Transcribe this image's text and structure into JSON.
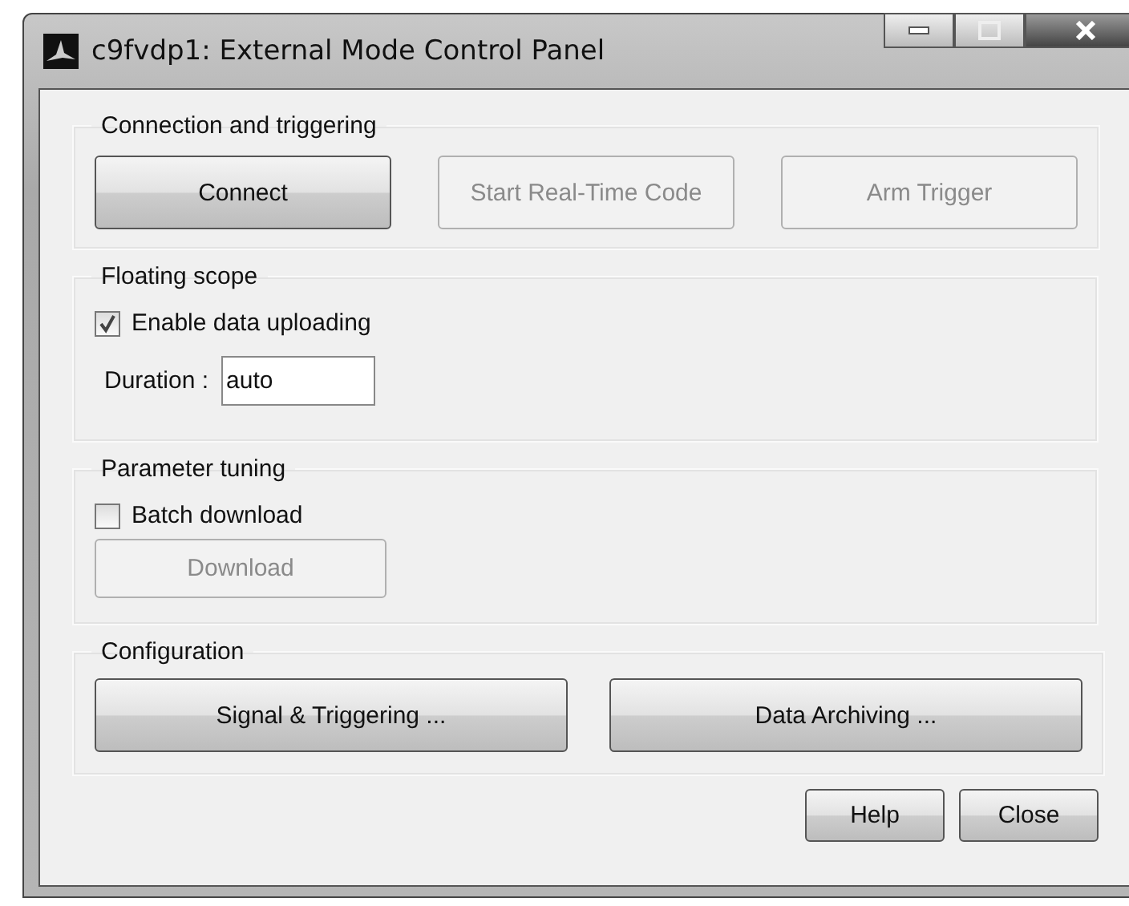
{
  "window": {
    "title": "c9fvdp1: External Mode Control Panel"
  },
  "connection": {
    "title": "Connection and triggering",
    "buttons": [
      {
        "label": "Connect",
        "disabled": false
      },
      {
        "label": "Start Real-Time Code",
        "disabled": true
      },
      {
        "label": "Arm Trigger",
        "disabled": true
      }
    ]
  },
  "floating_scope": {
    "title": "Floating scope",
    "checkbox": {
      "label": "Enable data uploading",
      "checked": true
    },
    "duration": {
      "label": "Duration :",
      "value": "auto"
    }
  },
  "parameter_tuning": {
    "title": "Parameter tuning",
    "checkbox": {
      "label": "Batch download",
      "checked": false
    },
    "button": {
      "label": "Download",
      "disabled": true
    }
  },
  "configuration": {
    "title": "Configuration",
    "buttons": [
      {
        "label": "Signal & Triggering ...",
        "disabled": false
      },
      {
        "label": "Data Archiving ...",
        "disabled": false
      }
    ]
  },
  "footer_buttons": [
    {
      "label": "Help",
      "disabled": false
    },
    {
      "label": "Close",
      "disabled": false
    }
  ]
}
